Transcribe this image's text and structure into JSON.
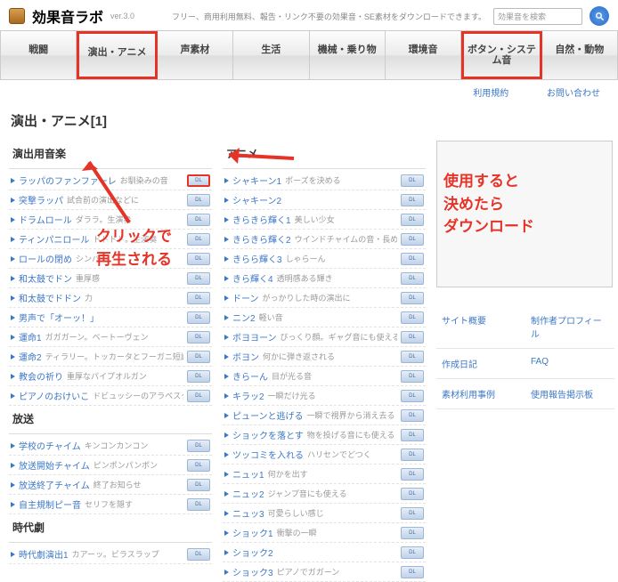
{
  "header": {
    "logo_text": "効果音ラボ",
    "version": "ver.3.0",
    "tagline": "フリー、商用利用無料、報告・リンク不要の効果音・SE素材をダウンロードできます。",
    "search_placeholder": "効果音を検索"
  },
  "nav": [
    {
      "label": "戦闘"
    },
    {
      "label": "演出・アニメ",
      "highlight": true
    },
    {
      "label": "声素材"
    },
    {
      "label": "生活"
    },
    {
      "label": "機械・乗り物"
    },
    {
      "label": "環境音"
    },
    {
      "label": "ボタン・システム音",
      "highlight": true,
      "multi": true
    },
    {
      "label": "自然・動物"
    }
  ],
  "sublinks": {
    "terms": "利用規約",
    "contact": "お問い合わせ"
  },
  "page_title": "演出・アニメ[1]",
  "left_sections": [
    {
      "title": "演出用音楽",
      "items": [
        {
          "name": "ラッパのファンファーレ",
          "desc": "お馴染みの音",
          "dl_highlight": true
        },
        {
          "name": "突撃ラッパ",
          "desc": "試合前の演出などに"
        },
        {
          "name": "ドラムロール",
          "desc": "ダララ。生演奏"
        },
        {
          "name": "ティンパニロール",
          "desc": "ドドドド。生演奏"
        },
        {
          "name": "ロールの閉め",
          "desc": "シンバ"
        },
        {
          "name": "和太鼓でドン",
          "desc": "重厚感"
        },
        {
          "name": "和太鼓でドドン",
          "desc": "力"
        },
        {
          "name": "男声で「オーッ！」",
          "desc": ""
        },
        {
          "name": "運命1",
          "desc": "ガガガーン。ベートーヴェン"
        },
        {
          "name": "運命2",
          "desc": "ティラリー。トッカータとフーガニ短調"
        },
        {
          "name": "教会の祈り",
          "desc": "重厚なパイプオルガン"
        },
        {
          "name": "ピアノのおけいこ",
          "desc": "ドビュッシーのアラベスクより"
        }
      ]
    },
    {
      "title": "放送",
      "items": [
        {
          "name": "学校のチャイム",
          "desc": "キンコンカンコン"
        },
        {
          "name": "放送開始チャイム",
          "desc": "ピンポンパンポン"
        },
        {
          "name": "放送終了チャイム",
          "desc": "終了お知らせ"
        },
        {
          "name": "自主規制ピー音",
          "desc": "セリフを隠す"
        }
      ]
    },
    {
      "title": "時代劇",
      "items": [
        {
          "name": "時代劇演出1",
          "desc": "カアーッ。ビラスラップ"
        }
      ]
    }
  ],
  "mid_sections": [
    {
      "title": "アニメ",
      "items": [
        {
          "name": "シャキーン1",
          "desc": "ポーズを決める"
        },
        {
          "name": "シャキーン2",
          "desc": ""
        },
        {
          "name": "きらきら輝く1",
          "desc": "美しい少女"
        },
        {
          "name": "きらきら輝く2",
          "desc": "ウインドチャイムの音・長め"
        },
        {
          "name": "きらら輝く3",
          "desc": "しゃらーん"
        },
        {
          "name": "きら輝く4",
          "desc": "透明感ある輝き"
        },
        {
          "name": "ドーン",
          "desc": "がっかりした時の演出に"
        },
        {
          "name": "ニン2",
          "desc": "軽い音"
        },
        {
          "name": "ボヨヨーン",
          "desc": "びっくり顔。ギャグ音にも使える"
        },
        {
          "name": "ボヨン",
          "desc": "何かに弾き返される"
        },
        {
          "name": "きらーん",
          "desc": "目が光る音"
        },
        {
          "name": "キラッ2",
          "desc": "一瞬だけ光る"
        },
        {
          "name": "ピューンと逃げる",
          "desc": "一瞬で視界から消え去る"
        },
        {
          "name": "ショックを落とす",
          "desc": "物を投げる音にも使える"
        },
        {
          "name": "ツッコミを入れる",
          "desc": "ハリセンでどつく"
        },
        {
          "name": "ニュッ1",
          "desc": "何かを出す"
        },
        {
          "name": "ニュッ2",
          "desc": "ジャンプ音にも使える"
        },
        {
          "name": "ニュッ3",
          "desc": "可愛らしい感じ"
        },
        {
          "name": "ショック1",
          "desc": "衝撃の一瞬"
        },
        {
          "name": "ショック2",
          "desc": ""
        },
        {
          "name": "ショック3",
          "desc": "ピアノでガガーン"
        }
      ]
    }
  ],
  "sidebar_links": [
    {
      "l": "サイト概要",
      "r": "制作者プロフィール"
    },
    {
      "l": "作成日記",
      "r": "FAQ"
    },
    {
      "l": "素材利用事例",
      "r": "使用報告掲示板"
    }
  ],
  "annotations": {
    "click_play": "クリックで\n再生される",
    "download": "使用すると\n決めたら\nダウンロード"
  }
}
